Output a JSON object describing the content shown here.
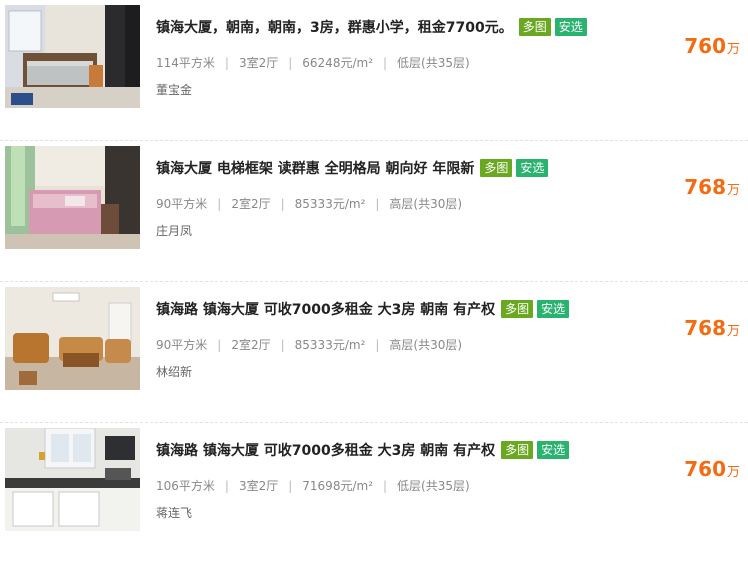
{
  "listings": [
    {
      "title": "镇海大厦，朝南，朝南，3房，群惠小学，租金7700元。",
      "tags": [
        "多图",
        "安选"
      ],
      "area": "114平方米",
      "layout": "3室2厅",
      "unit_price": "66248元/m²",
      "floor": "低层(共35层)",
      "agent": "董宝金",
      "price": "760",
      "price_unit": "万"
    },
    {
      "title": "镇海大厦 电梯框架 读群惠 全明格局 朝向好 年限新",
      "tags": [
        "多图",
        "安选"
      ],
      "area": "90平方米",
      "layout": "2室2厅",
      "unit_price": "85333元/m²",
      "floor": "高层(共30层)",
      "agent": "庄月凤",
      "price": "768",
      "price_unit": "万"
    },
    {
      "title": "镇海路 镇海大厦 可收7000多租金 大3房 朝南 有产权",
      "tags": [
        "多图",
        "安选"
      ],
      "area": "90平方米",
      "layout": "2室2厅",
      "unit_price": "85333元/m²",
      "floor": "高层(共30层)",
      "agent": "林绍新",
      "price": "768",
      "price_unit": "万"
    },
    {
      "title": "镇海路 镇海大厦 可收7000多租金 大3房 朝南 有产权",
      "tags": [
        "多图",
        "安选"
      ],
      "area": "106平方米",
      "layout": "3室2厅",
      "unit_price": "71698元/m²",
      "floor": "低层(共35层)",
      "agent": "蒋连飞",
      "price": "760",
      "price_unit": "万"
    }
  ]
}
